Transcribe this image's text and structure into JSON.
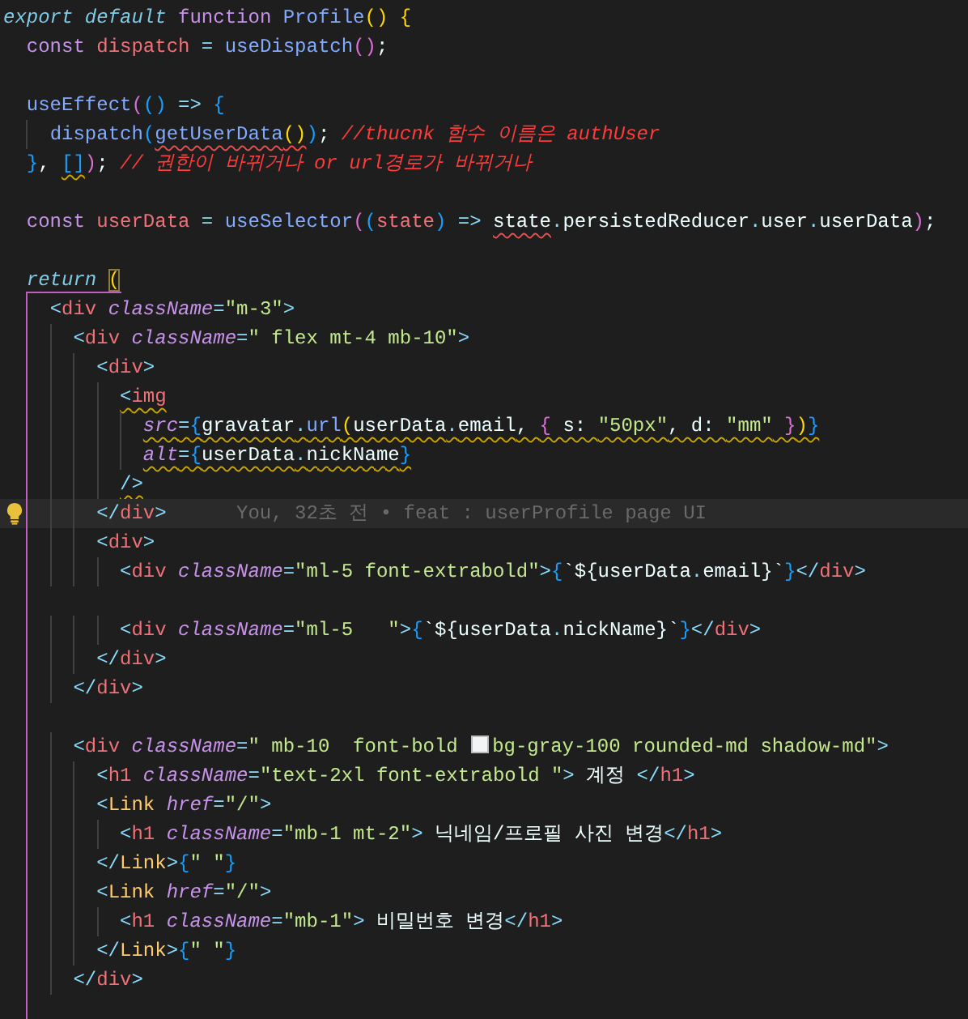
{
  "editor": {
    "lines": [
      {
        "kind": "code",
        "current": false,
        "tokens": [
          {
            "text": "export default ",
            "kind": "keyword"
          },
          {
            "text": "function ",
            "kind": "storage"
          },
          {
            "text": "Profile",
            "kind": "function"
          },
          {
            "text": "()",
            "kind": "bracket1"
          },
          {
            "text": " {",
            "kind": "bracket1"
          }
        ]
      },
      {
        "kind": "code",
        "current": false,
        "tokens": [
          {
            "text": "  const ",
            "kind": "storage"
          },
          {
            "text": "dispatch",
            "kind": "variable"
          },
          {
            "text": " = ",
            "kind": "operator"
          },
          {
            "text": "useDispatch",
            "kind": "function"
          },
          {
            "text": "()",
            "kind": "bracket2"
          },
          {
            "text": ";",
            "kind": "text"
          }
        ]
      },
      {
        "kind": "blank",
        "current": false
      },
      {
        "kind": "code",
        "current": false,
        "tokens": [
          {
            "text": "  useEffect",
            "kind": "function"
          },
          {
            "text": "(",
            "kind": "bracket2"
          },
          {
            "text": "()",
            "kind": "bracket3"
          },
          {
            "text": " => ",
            "kind": "operator"
          },
          {
            "text": "{",
            "kind": "bracket3"
          }
        ]
      },
      {
        "kind": "code",
        "current": false,
        "tokens": [
          {
            "text": "    dispatch",
            "kind": "function"
          },
          {
            "text": "(",
            "kind": "bracket3"
          },
          {
            "text": "getUserData",
            "kind": "function",
            "error": true
          },
          {
            "text": "()",
            "kind": "bracket1",
            "error": true
          },
          {
            "text": ")",
            "kind": "bracket3"
          },
          {
            "text": ";",
            "kind": "text"
          },
          {
            "text": " //thucnk 함수 이름은 authUser",
            "kind": "comment"
          }
        ]
      },
      {
        "kind": "code",
        "current": false,
        "tokens": [
          {
            "text": "  }",
            "kind": "bracket3"
          },
          {
            "text": ", ",
            "kind": "text"
          },
          {
            "text": "[]",
            "kind": "bracket3",
            "warning": true
          },
          {
            "text": ")",
            "kind": "bracket2"
          },
          {
            "text": ";",
            "kind": "text"
          },
          {
            "text": " // 권한이 바뀌거나 or url경로가 바뀌거나",
            "kind": "comment"
          }
        ]
      },
      {
        "kind": "blank",
        "current": false
      },
      {
        "kind": "code",
        "current": false,
        "tokens": [
          {
            "text": "  const ",
            "kind": "storage"
          },
          {
            "text": "userData",
            "kind": "variable"
          },
          {
            "text": " = ",
            "kind": "operator"
          },
          {
            "text": "useSelector",
            "kind": "function"
          },
          {
            "text": "(",
            "kind": "bracket2"
          },
          {
            "text": "(",
            "kind": "bracket3"
          },
          {
            "text": "state",
            "kind": "variable"
          },
          {
            "text": ")",
            "kind": "bracket3"
          },
          {
            "text": " => ",
            "kind": "operator"
          },
          {
            "text": "state",
            "kind": "text",
            "error": true
          },
          {
            "text": ".",
            "kind": "operator"
          },
          {
            "text": "persistedReducer",
            "kind": "text"
          },
          {
            "text": ".",
            "kind": "operator"
          },
          {
            "text": "user",
            "kind": "text"
          },
          {
            "text": ".",
            "kind": "operator"
          },
          {
            "text": "userData",
            "kind": "text"
          },
          {
            "text": ")",
            "kind": "bracket2"
          },
          {
            "text": ";",
            "kind": "text"
          }
        ]
      },
      {
        "kind": "blank",
        "current": false
      },
      {
        "kind": "code",
        "current": false,
        "tokens": [
          {
            "text": "  return ",
            "kind": "keyword"
          },
          {
            "text": "(",
            "kind": "bracket1",
            "matched": true
          }
        ]
      },
      {
        "kind": "code",
        "current": false,
        "tokens": [
          {
            "text": "    <",
            "kind": "punctuation"
          },
          {
            "text": "div",
            "kind": "tag"
          },
          {
            "text": " className",
            "kind": "attribute"
          },
          {
            "text": "=",
            "kind": "operator"
          },
          {
            "text": "\"m-3\"",
            "kind": "string"
          },
          {
            "text": ">",
            "kind": "punctuation"
          }
        ]
      },
      {
        "kind": "code",
        "current": false,
        "tokens": [
          {
            "text": "      <",
            "kind": "punctuation"
          },
          {
            "text": "div",
            "kind": "tag"
          },
          {
            "text": " className",
            "kind": "attribute"
          },
          {
            "text": "=",
            "kind": "operator"
          },
          {
            "text": "\" flex mt-4 mb-10\"",
            "kind": "string"
          },
          {
            "text": ">",
            "kind": "punctuation"
          }
        ]
      },
      {
        "kind": "code",
        "current": false,
        "tokens": [
          {
            "text": "        <",
            "kind": "punctuation"
          },
          {
            "text": "div",
            "kind": "tag"
          },
          {
            "text": ">",
            "kind": "punctuation"
          }
        ]
      },
      {
        "kind": "code",
        "current": false,
        "tokens": [
          {
            "text": "          <",
            "kind": "punctuation",
            "warning": true
          },
          {
            "text": "img",
            "kind": "tag",
            "warning": true
          }
        ]
      },
      {
        "kind": "code",
        "current": false,
        "warning": true,
        "tokens": [
          {
            "text": "            src",
            "kind": "attribute"
          },
          {
            "text": "=",
            "kind": "operator"
          },
          {
            "text": "{",
            "kind": "bracket3"
          },
          {
            "text": "gravatar",
            "kind": "text"
          },
          {
            "text": ".",
            "kind": "operator"
          },
          {
            "text": "url",
            "kind": "function"
          },
          {
            "text": "(",
            "kind": "bracket1"
          },
          {
            "text": "userData",
            "kind": "text"
          },
          {
            "text": ".",
            "kind": "operator"
          },
          {
            "text": "email",
            "kind": "text"
          },
          {
            "text": ", ",
            "kind": "text"
          },
          {
            "text": "{",
            "kind": "bracket2"
          },
          {
            "text": " s: ",
            "kind": "text"
          },
          {
            "text": "\"50px\"",
            "kind": "string"
          },
          {
            "text": ", d: ",
            "kind": "text"
          },
          {
            "text": "\"mm\"",
            "kind": "string"
          },
          {
            "text": " }",
            "kind": "bracket2"
          },
          {
            "text": ")",
            "kind": "bracket1"
          },
          {
            "text": "}",
            "kind": "bracket3"
          }
        ]
      },
      {
        "kind": "code",
        "current": false,
        "warning": true,
        "tokens": [
          {
            "text": "            alt",
            "kind": "attribute"
          },
          {
            "text": "=",
            "kind": "operator"
          },
          {
            "text": "{",
            "kind": "bracket3"
          },
          {
            "text": "userData",
            "kind": "text"
          },
          {
            "text": ".",
            "kind": "operator"
          },
          {
            "text": "nickName",
            "kind": "text"
          },
          {
            "text": "}",
            "kind": "bracket3"
          }
        ]
      },
      {
        "kind": "code",
        "current": false,
        "warning": true,
        "tokens": [
          {
            "text": "          />",
            "kind": "punctuation"
          }
        ]
      },
      {
        "kind": "code",
        "current": true,
        "blame": "You, 32초 전 • feat : userProfile page UI",
        "tokens": [
          {
            "text": "        </",
            "kind": "punctuation"
          },
          {
            "text": "div",
            "kind": "tag"
          },
          {
            "text": ">",
            "kind": "punctuation"
          }
        ]
      },
      {
        "kind": "code",
        "current": false,
        "tokens": [
          {
            "text": "        <",
            "kind": "punctuation"
          },
          {
            "text": "div",
            "kind": "tag"
          },
          {
            "text": ">",
            "kind": "punctuation"
          }
        ]
      },
      {
        "kind": "code",
        "current": false,
        "tokens": [
          {
            "text": "          <",
            "kind": "punctuation"
          },
          {
            "text": "div",
            "kind": "tag"
          },
          {
            "text": " className",
            "kind": "attribute"
          },
          {
            "text": "=",
            "kind": "operator"
          },
          {
            "text": "\"ml-5 font-extrabold\"",
            "kind": "string"
          },
          {
            "text": ">",
            "kind": "punctuation"
          },
          {
            "text": "{",
            "kind": "bracket3"
          },
          {
            "text": "`${userData",
            "kind": "text"
          },
          {
            "text": ".",
            "kind": "operator"
          },
          {
            "text": "email}`",
            "kind": "text"
          },
          {
            "text": "}",
            "kind": "bracket3"
          },
          {
            "text": "</",
            "kind": "punctuation"
          },
          {
            "text": "div",
            "kind": "tag"
          },
          {
            "text": ">",
            "kind": "punctuation"
          }
        ]
      },
      {
        "kind": "blank",
        "current": false
      },
      {
        "kind": "code",
        "current": false,
        "tokens": [
          {
            "text": "          <",
            "kind": "punctuation"
          },
          {
            "text": "div",
            "kind": "tag"
          },
          {
            "text": " className",
            "kind": "attribute"
          },
          {
            "text": "=",
            "kind": "operator"
          },
          {
            "text": "\"ml-5   \"",
            "kind": "string"
          },
          {
            "text": ">",
            "kind": "punctuation"
          },
          {
            "text": "{",
            "kind": "bracket3"
          },
          {
            "text": "`${userData",
            "kind": "text"
          },
          {
            "text": ".",
            "kind": "operator"
          },
          {
            "text": "nickName}`",
            "kind": "text"
          },
          {
            "text": "}",
            "kind": "bracket3"
          },
          {
            "text": "</",
            "kind": "punctuation"
          },
          {
            "text": "div",
            "kind": "tag"
          },
          {
            "text": ">",
            "kind": "punctuation"
          }
        ]
      },
      {
        "kind": "code",
        "current": false,
        "tokens": [
          {
            "text": "        </",
            "kind": "punctuation"
          },
          {
            "text": "div",
            "kind": "tag"
          },
          {
            "text": ">",
            "kind": "punctuation"
          }
        ]
      },
      {
        "kind": "code",
        "current": false,
        "tokens": [
          {
            "text": "      </",
            "kind": "punctuation"
          },
          {
            "text": "div",
            "kind": "tag"
          },
          {
            "text": ">",
            "kind": "punctuation"
          }
        ]
      },
      {
        "kind": "blank",
        "current": false
      },
      {
        "kind": "code",
        "current": false,
        "tokens": [
          {
            "text": "      <",
            "kind": "punctuation"
          },
          {
            "text": "div",
            "kind": "tag"
          },
          {
            "text": " className",
            "kind": "attribute"
          },
          {
            "text": "=",
            "kind": "operator"
          },
          {
            "text": "\" mb-10  font-bold ",
            "kind": "string"
          },
          {
            "kind": "swatch",
            "color": "#f3f4f6"
          },
          {
            "text": "bg-gray-100 rounded-md shadow-md\"",
            "kind": "string"
          },
          {
            "text": ">",
            "kind": "punctuation"
          }
        ]
      },
      {
        "kind": "code",
        "current": false,
        "tokens": [
          {
            "text": "        <",
            "kind": "punctuation"
          },
          {
            "text": "h1",
            "kind": "tag"
          },
          {
            "text": " className",
            "kind": "attribute"
          },
          {
            "text": "=",
            "kind": "operator"
          },
          {
            "text": "\"text-2xl font-extrabold \"",
            "kind": "string"
          },
          {
            "text": ">",
            "kind": "punctuation"
          },
          {
            "text": " 계정 ",
            "kind": "text"
          },
          {
            "text": "</",
            "kind": "punctuation"
          },
          {
            "text": "h1",
            "kind": "tag"
          },
          {
            "text": ">",
            "kind": "punctuation"
          }
        ]
      },
      {
        "kind": "code",
        "current": false,
        "tokens": [
          {
            "text": "        <",
            "kind": "punctuation"
          },
          {
            "text": "Link",
            "kind": "component"
          },
          {
            "text": " href",
            "kind": "attribute"
          },
          {
            "text": "=",
            "kind": "operator"
          },
          {
            "text": "\"/\"",
            "kind": "string"
          },
          {
            "text": ">",
            "kind": "punctuation"
          }
        ]
      },
      {
        "kind": "code",
        "current": false,
        "tokens": [
          {
            "text": "          <",
            "kind": "punctuation"
          },
          {
            "text": "h1",
            "kind": "tag"
          },
          {
            "text": " className",
            "kind": "attribute"
          },
          {
            "text": "=",
            "kind": "operator"
          },
          {
            "text": "\"mb-1 mt-2\"",
            "kind": "string"
          },
          {
            "text": ">",
            "kind": "punctuation"
          },
          {
            "text": " 닉네임/프로필 사진 변경",
            "kind": "text"
          },
          {
            "text": "</",
            "kind": "punctuation"
          },
          {
            "text": "h1",
            "kind": "tag"
          },
          {
            "text": ">",
            "kind": "punctuation"
          }
        ]
      },
      {
        "kind": "code",
        "current": false,
        "tokens": [
          {
            "text": "        </",
            "kind": "punctuation"
          },
          {
            "text": "Link",
            "kind": "component"
          },
          {
            "text": ">",
            "kind": "punctuation"
          },
          {
            "text": "{",
            "kind": "bracket3"
          },
          {
            "text": "\" \"",
            "kind": "string"
          },
          {
            "text": "}",
            "kind": "bracket3"
          }
        ]
      },
      {
        "kind": "code",
        "current": false,
        "tokens": [
          {
            "text": "        <",
            "kind": "punctuation"
          },
          {
            "text": "Link",
            "kind": "component"
          },
          {
            "text": " href",
            "kind": "attribute"
          },
          {
            "text": "=",
            "kind": "operator"
          },
          {
            "text": "\"/\"",
            "kind": "string"
          },
          {
            "text": ">",
            "kind": "punctuation"
          }
        ]
      },
      {
        "kind": "code",
        "current": false,
        "tokens": [
          {
            "text": "          <",
            "kind": "punctuation"
          },
          {
            "text": "h1",
            "kind": "tag"
          },
          {
            "text": " className",
            "kind": "attribute"
          },
          {
            "text": "=",
            "kind": "operator"
          },
          {
            "text": "\"mb-1\"",
            "kind": "string"
          },
          {
            "text": ">",
            "kind": "punctuation"
          },
          {
            "text": " 비밀번호 변경",
            "kind": "text"
          },
          {
            "text": "</",
            "kind": "punctuation"
          },
          {
            "text": "h1",
            "kind": "tag"
          },
          {
            "text": ">",
            "kind": "punctuation"
          }
        ]
      },
      {
        "kind": "code",
        "current": false,
        "tokens": [
          {
            "text": "        </",
            "kind": "punctuation"
          },
          {
            "text": "Link",
            "kind": "component"
          },
          {
            "text": ">",
            "kind": "punctuation"
          },
          {
            "text": "{",
            "kind": "bracket3"
          },
          {
            "text": "\" \"",
            "kind": "string"
          },
          {
            "text": "}",
            "kind": "bracket3"
          }
        ]
      },
      {
        "kind": "code",
        "current": false,
        "tokens": [
          {
            "text": "      </",
            "kind": "punctuation"
          },
          {
            "text": "div",
            "kind": "tag"
          },
          {
            "text": ">",
            "kind": "punctuation"
          }
        ]
      }
    ]
  }
}
